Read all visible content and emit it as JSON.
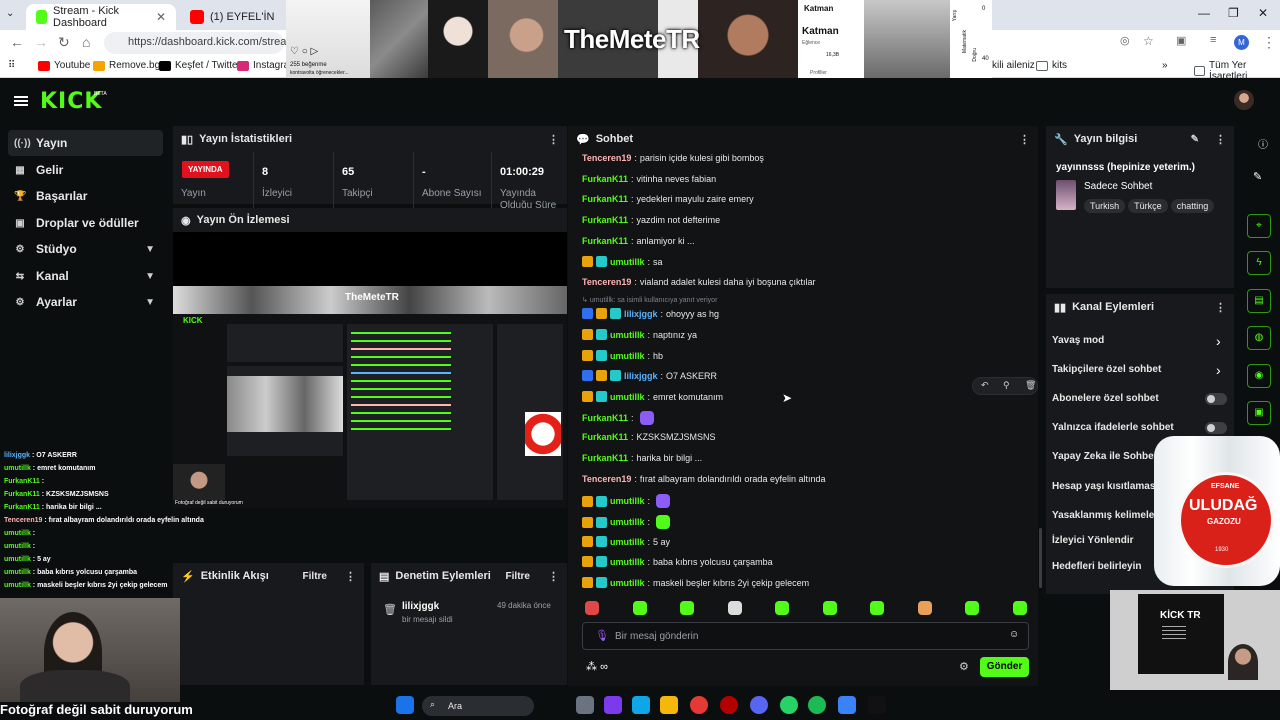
{
  "browser": {
    "tabs": [
      {
        "title": "Stream - Kick Dashboard",
        "active": true
      },
      {
        "title": "(1) EYFEL'İN",
        "active": false
      }
    ],
    "url": "https://dashboard.kick.com/stream",
    "bookmarks": [
      "Youtube",
      "Remove.bg",
      "Keşfet / Twitter",
      "Instagram",
      "kili aileniz",
      "kits",
      "Tüm Yer İşaretleri"
    ]
  },
  "overlay": {
    "title": "TheMeteTR",
    "card_like_text": "255 beğenme",
    "card_sub_text": "kontravolta öğrenecekler...",
    "card_katman": "Katman",
    "card_katman2": "Katman",
    "card_small": "Eğlence",
    "card_number": "16,3B",
    "card_side": "Yarış",
    "card_side2": "Matematik",
    "card_side3": "Doğru",
    "card_num2": "40",
    "card_num3": "0",
    "card_profile": "Profiller"
  },
  "app": {
    "logo": "KICK",
    "beta": "BETA"
  },
  "sidebar": {
    "items": [
      {
        "label": "Yayın",
        "icon": "((·))"
      },
      {
        "label": "Gelir",
        "icon": "▦"
      },
      {
        "label": "Başarılar",
        "icon": "🏆"
      },
      {
        "label": "Droplar ve ödüller",
        "icon": "▣"
      },
      {
        "label": "Stüdyo",
        "icon": "⚙"
      },
      {
        "label": "Kanal",
        "icon": "⇆"
      },
      {
        "label": "Ayarlar",
        "icon": "⚙"
      }
    ]
  },
  "stats": {
    "title": "Yayın İstatistikleri",
    "live": "YAYINDA",
    "items": [
      {
        "value": "",
        "label": "Yayın"
      },
      {
        "value": "8",
        "label": "İzleyici"
      },
      {
        "value": "65",
        "label": "Takipçi"
      },
      {
        "value": "-",
        "label": "Abone Sayısı"
      },
      {
        "value": "01:00:29",
        "label": "Yayında Olduğu Süre"
      }
    ]
  },
  "preview": {
    "title": "Yayın Ön İzlemesi",
    "mini_title": "TheMeteTR",
    "cam_caption": "Fotoğraf değil sabit duruyorum"
  },
  "activity": {
    "title": "Etkinlik Akışı",
    "filter": "Filtre"
  },
  "moderation": {
    "title": "Denetim Eylemleri",
    "filter": "Filtre",
    "entry_user": "lilixjggk",
    "entry_action": "bir mesajı sildi",
    "entry_time": "49 dakika önce"
  },
  "chat": {
    "title": "Sohbet",
    "reply_hint": "umutillk: sa isimli kullanıcıya yanıt veriyor",
    "messages": [
      {
        "user": "Tenceren19",
        "text": "parisin içide kulesi gibi bomboş",
        "color": "#ffb3b3",
        "badges": 0
      },
      {
        "user": "FurkanK11",
        "text": "vitinha neves fabian",
        "color": "#53fc18",
        "badges": 0
      },
      {
        "user": "FurkanK11",
        "text": "yedekleri mayulu zaire emery",
        "color": "#53fc18",
        "badges": 0
      },
      {
        "user": "FurkanK11",
        "text": "yazdim not defterime",
        "color": "#53fc18",
        "badges": 0
      },
      {
        "user": "FurkanK11",
        "text": "anlamiyor ki ...",
        "color": "#53fc18",
        "badges": 0
      },
      {
        "user": "umutillk",
        "text": "sa",
        "color": "#53fc18",
        "badges": 2
      },
      {
        "user": "Tenceren19",
        "text": "vialand adalet kulesi daha iyi boşuna çıktılar",
        "color": "#ffb3b3",
        "badges": 0
      },
      {
        "user": "lilixjggk",
        "text": "ohoyyy as hg",
        "color": "#5ab4ff",
        "badges": 3
      },
      {
        "user": "umutillk",
        "text": "naptınız ya",
        "color": "#53fc18",
        "badges": 2
      },
      {
        "user": "umutillk",
        "text": "hb",
        "color": "#53fc18",
        "badges": 2
      },
      {
        "user": "lilixjggk",
        "text": "O7 ASKERR",
        "color": "#5ab4ff",
        "badges": 3
      },
      {
        "user": "umutillk",
        "text": "emret komutanım",
        "color": "#53fc18",
        "badges": 2
      },
      {
        "user": "FurkanK11",
        "text": "",
        "color": "#53fc18",
        "badges": 0
      },
      {
        "user": "FurkanK11",
        "text": "KZSKSMZJSMSNS",
        "color": "#53fc18",
        "badges": 0
      },
      {
        "user": "FurkanK11",
        "text": "harika bir bilgi ...",
        "color": "#53fc18",
        "badges": 0
      },
      {
        "user": "Tenceren19",
        "text": "fırat albayram dolandırıldı orada eyfelin altında",
        "color": "#ffb3b3",
        "badges": 0
      },
      {
        "user": "umutillk",
        "text": "",
        "color": "#53fc18",
        "badges": 2
      },
      {
        "user": "umutillk",
        "text": "",
        "color": "#53fc18",
        "badges": 2
      },
      {
        "user": "umutillk",
        "text": "5 ay",
        "color": "#53fc18",
        "badges": 2
      },
      {
        "user": "umutillk",
        "text": "baba kıbrıs yolcusu çarşamba",
        "color": "#53fc18",
        "badges": 2
      },
      {
        "user": "umutillk",
        "text": "maskeli beşler kıbrıs 2yi çekip gelecem",
        "color": "#53fc18",
        "badges": 2
      }
    ],
    "input_placeholder": "Bir mesaj gönderin",
    "send_label": "Gönder"
  },
  "stream_info": {
    "title": "Yayın bilgisi",
    "stream_title": "yayınnsss (hepinize yeterim.)",
    "category": "Sadece Sohbet",
    "tags": [
      "Turkish",
      "Türkçe",
      "chatting"
    ]
  },
  "channel_actions": {
    "title": "Kanal Eylemleri",
    "items": [
      {
        "label": "Yavaş mod",
        "control": "chevron"
      },
      {
        "label": "Takipçilere özel sohbet",
        "control": "chevron"
      },
      {
        "label": "Abonelere özel sohbet",
        "control": "toggle"
      },
      {
        "label": "Yalnızca ifadelerle sohbet",
        "control": "toggle"
      },
      {
        "label": "Yapay Zeka ile Sohbet",
        "control": "none"
      },
      {
        "label": "Hesap yaşı kısıtlaması",
        "control": "none"
      },
      {
        "label": "Yasaklanmış kelimeler",
        "control": "none"
      },
      {
        "label": "İzleyici Yönlendir",
        "control": "none"
      },
      {
        "label": "Hedefleri belirleyin",
        "control": "none"
      }
    ]
  },
  "left_overlay_chat": [
    {
      "user": "lilixjggk",
      "text": "O7 ASKERR"
    },
    {
      "user": "umutillk",
      "text": "emret komutanım"
    },
    {
      "user": "FurkanK11",
      "text": ""
    },
    {
      "user": "FurkanK11",
      "text": "KZSKSMZJSMSNS"
    },
    {
      "user": "FurkanK11",
      "text": "harika bir bilgi ..."
    },
    {
      "user": "Tenceren19",
      "text": "fırat albayram dolandırıldı orada eyfelin altında"
    },
    {
      "user": "umutillk",
      "text": ""
    },
    {
      "user": "umutillk",
      "text": ""
    },
    {
      "user": "umutillk",
      "text": "5 ay"
    },
    {
      "user": "umutillk",
      "text": "baba kıbrıs yolcusu çarşamba"
    },
    {
      "user": "umutillk",
      "text": "maskeli beşler kıbrıs 2yi çekip gelecem"
    }
  ],
  "product": {
    "brand": "ULUDAĞ",
    "sub": "GAZOZU",
    "top": "EFSANE",
    "year": "1930"
  },
  "kick_tr_screen": {
    "title": "KİCK TR"
  },
  "taskbar": {
    "search": "Ara"
  },
  "colors": {
    "kick_green": "#53fc18",
    "live_red": "#e1111e",
    "panel": "#18191c",
    "bg": "#0b0e0f"
  }
}
